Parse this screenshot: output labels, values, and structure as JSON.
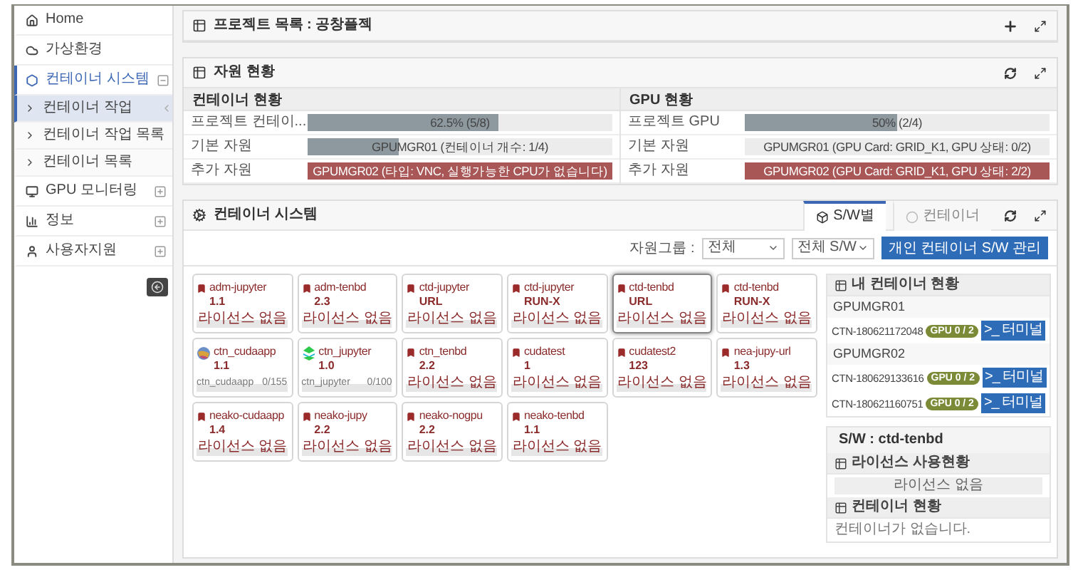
{
  "sidebar": {
    "items": [
      {
        "label": "Home",
        "kind": "link",
        "selected": false
      },
      {
        "label": "가상환경",
        "kind": "link",
        "selected": false
      },
      {
        "label": "컨테이너 시스템",
        "kind": "group",
        "expanded": true,
        "selected": true,
        "children": [
          {
            "label": "컨테이너 작업",
            "selected": true
          },
          {
            "label": "컨테이너 작업 목록",
            "selected": false
          },
          {
            "label": "컨테이너 목록",
            "selected": false
          }
        ]
      },
      {
        "label": "GPU 모니터링",
        "kind": "group",
        "expanded": false,
        "selected": false
      },
      {
        "label": "정보",
        "kind": "group",
        "expanded": false,
        "selected": false
      },
      {
        "label": "사용자지원",
        "kind": "group",
        "expanded": false,
        "selected": false
      }
    ]
  },
  "project_panel": {
    "title": "프로젝트 목록 : 공창플젝"
  },
  "resource_panel": {
    "title": "자원 현황",
    "sections": [
      {
        "heading": "컨테이너 현황",
        "rows": [
          {
            "label": "프로젝트 컨테이...",
            "level": 0.625,
            "reading": "62.5% (5/8)",
            "color": "#8d999f"
          },
          {
            "label": "기본 자원",
            "level": 0.3,
            "reading": "GPUMGR01 (컨테이너 개수: 1/4)",
            "color": "#8d999f"
          },
          {
            "label": "추가 자원",
            "level": 1,
            "reading": "GPUMGR02 (타입: VNC, 실행가능한 CPU가 없습니다)",
            "color": "#a85656"
          }
        ]
      },
      {
        "heading": "GPU 현황",
        "rows": [
          {
            "label": "프로젝트 GPU",
            "level": 0.5,
            "reading": "50% (2/4)",
            "color": "#8d999f"
          },
          {
            "label": "기본 자원",
            "reading": "GPUMGR01 (GPU Card: GRID_K1, GPU 상태: 0/2)"
          },
          {
            "label": "추가 자원",
            "level": 1,
            "reading": "GPUMGR02 (GPU Card: GRID_K1, GPU 상태: 2/2)",
            "color": "#a85656"
          }
        ]
      }
    ]
  },
  "container_panel": {
    "title": "컨테이너 시스템",
    "tabs": [
      {
        "label": "S/W별",
        "selected": true
      },
      {
        "label": "컨테이너",
        "selected": false
      }
    ],
    "filter": {
      "label": "자원그룹 :",
      "selects": [
        "전체",
        "전체 S/W"
      ],
      "button": "개인 컨테이너 S/W 관리"
    },
    "cards": [
      {
        "name": "adm-jupyter",
        "version": "1.1",
        "kind": "license",
        "footer": "라이선스 없음",
        "selected": false
      },
      {
        "name": "adm-tenbd",
        "version": "2.3",
        "kind": "license",
        "footer": "라이선스 없음",
        "selected": false
      },
      {
        "name": "ctd-jupyter",
        "version": "URL",
        "kind": "license",
        "footer": "라이선스 없음",
        "selected": false
      },
      {
        "name": "ctd-jupyter",
        "version": "RUN-X",
        "kind": "license",
        "footer": "라이선스 없음",
        "selected": false
      },
      {
        "name": "ctd-tenbd",
        "version": "URL",
        "kind": "license",
        "footer": "라이선스 없음",
        "selected": true
      },
      {
        "name": "ctd-tenbd",
        "version": "RUN-X",
        "kind": "license",
        "footer": "라이선스 없음",
        "selected": false
      },
      {
        "name": "ctn_cudaapp",
        "version": "1.1",
        "kind": "usage",
        "footer": "ctn_cudaapp",
        "count": "0/155",
        "selected": false
      },
      {
        "name": "ctn_jupyter",
        "version": "1.0",
        "kind": "usage",
        "footer": "ctn_jupyter",
        "count": "0/100",
        "selected": false
      },
      {
        "name": "ctn_tenbd",
        "version": "2.2",
        "kind": "license",
        "footer": "라이선스 없음",
        "selected": false
      },
      {
        "name": "cudatest",
        "version": "1",
        "kind": "license",
        "footer": "라이선스 없음",
        "selected": false
      },
      {
        "name": "cudatest2",
        "version": "123",
        "kind": "license",
        "footer": "라이선스 없음",
        "selected": false
      },
      {
        "name": "nea-jupy-url",
        "version": "1.3",
        "kind": "license",
        "footer": "라이선스 없음",
        "selected": false
      },
      {
        "name": "neako-cudaapp",
        "version": "1.4",
        "kind": "license",
        "footer": "라이선스 없음",
        "selected": false
      },
      {
        "name": "neako-jupy",
        "version": "2.2",
        "kind": "license",
        "footer": "라이선스 없음",
        "selected": false
      },
      {
        "name": "neako-nogpu",
        "version": "2.2",
        "kind": "license",
        "footer": "라이선스 없음",
        "selected": false
      },
      {
        "name": "neako-tenbd",
        "version": "1.1",
        "kind": "license",
        "footer": "라이선스 없음",
        "selected": false
      }
    ],
    "my_containers": {
      "title": "내 컨테이너 현황",
      "groups": [
        {
          "name": "GPUMGR01",
          "containers": [
            {
              "id": "CTN-180621172048",
              "badge": "GPU 0 / 2",
              "button": ">_ 터미널"
            }
          ]
        },
        {
          "name": "GPUMGR02",
          "containers": [
            {
              "id": "CTN-180629133616",
              "badge": "GPU 0 / 2",
              "button": ">_ 터미널"
            },
            {
              "id": "CTN-180621160751",
              "badge": "GPU 0 / 2",
              "button": ">_ 터미널"
            }
          ]
        }
      ]
    },
    "detail": {
      "title": "S/W : ctd-tenbd",
      "license_title": "라이선스 사용현황",
      "license_text": "라이선스 없음",
      "container_title": "컨테이너 현황",
      "container_text": "컨테이너가 없습니다."
    }
  }
}
